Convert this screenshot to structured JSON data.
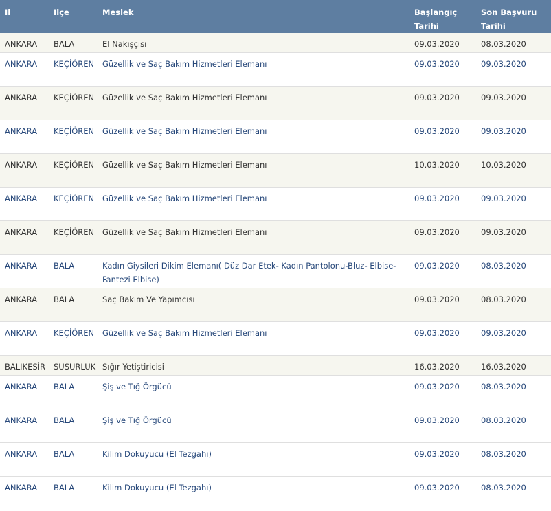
{
  "columns": [
    "Il",
    "Ilçe",
    "Meslek",
    "Başlangıç Tarihi",
    "Son Başvuru Tarihi"
  ],
  "rows": [
    [
      "ANKARA",
      "BALA",
      "El Nakışçısı",
      "09.03.2020",
      "08.03.2020"
    ],
    [
      "ANKARA",
      "KEÇİÖREN",
      "Güzellik ve Saç Bakım Hizmetleri Elemanı",
      "09.03.2020",
      "09.03.2020"
    ],
    [
      "ANKARA",
      "KEÇİÖREN",
      "Güzellik ve Saç Bakım Hizmetleri Elemanı",
      "09.03.2020",
      "09.03.2020"
    ],
    [
      "ANKARA",
      "KEÇİÖREN",
      "Güzellik ve Saç Bakım Hizmetleri Elemanı",
      "09.03.2020",
      "09.03.2020"
    ],
    [
      "ANKARA",
      "KEÇİÖREN",
      "Güzellik ve Saç Bakım Hizmetleri Elemanı",
      "10.03.2020",
      "10.03.2020"
    ],
    [
      "ANKARA",
      "KEÇİÖREN",
      "Güzellik ve Saç Bakım Hizmetleri Elemanı",
      "09.03.2020",
      "09.03.2020"
    ],
    [
      "ANKARA",
      "KEÇİÖREN",
      "Güzellik ve Saç Bakım Hizmetleri Elemanı",
      "09.03.2020",
      "09.03.2020"
    ],
    [
      "ANKARA",
      "BALA",
      "Kadın Giysileri Dikim Elemanı( Düz Dar Etek- Kadın Pantolonu-Bluz- Elbise- Fantezi Elbise)",
      "09.03.2020",
      "08.03.2020"
    ],
    [
      "ANKARA",
      "BALA",
      "Saç Bakım Ve Yapımcısı",
      "09.03.2020",
      "08.03.2020"
    ],
    [
      "ANKARA",
      "KEÇİÖREN",
      "Güzellik ve Saç Bakım Hizmetleri Elemanı",
      "09.03.2020",
      "09.03.2020"
    ],
    [
      "BALIKESİR",
      "SUSURLUK",
      "Sığır Yetiştiricisi",
      "16.03.2020",
      "16.03.2020"
    ],
    [
      "ANKARA",
      "BALA",
      "Şiş ve Tığ Örgücü",
      "09.03.2020",
      "08.03.2020"
    ],
    [
      "ANKARA",
      "BALA",
      "Şiş ve Tığ Örgücü",
      "09.03.2020",
      "08.03.2020"
    ],
    [
      "ANKARA",
      "BALA",
      "Kilim Dokuyucu (El Tezgahı)",
      "09.03.2020",
      "08.03.2020"
    ],
    [
      "ANKARA",
      "BALA",
      "Kilim Dokuyucu (El Tezgahı)",
      "09.03.2020",
      "08.03.2020"
    ]
  ]
}
